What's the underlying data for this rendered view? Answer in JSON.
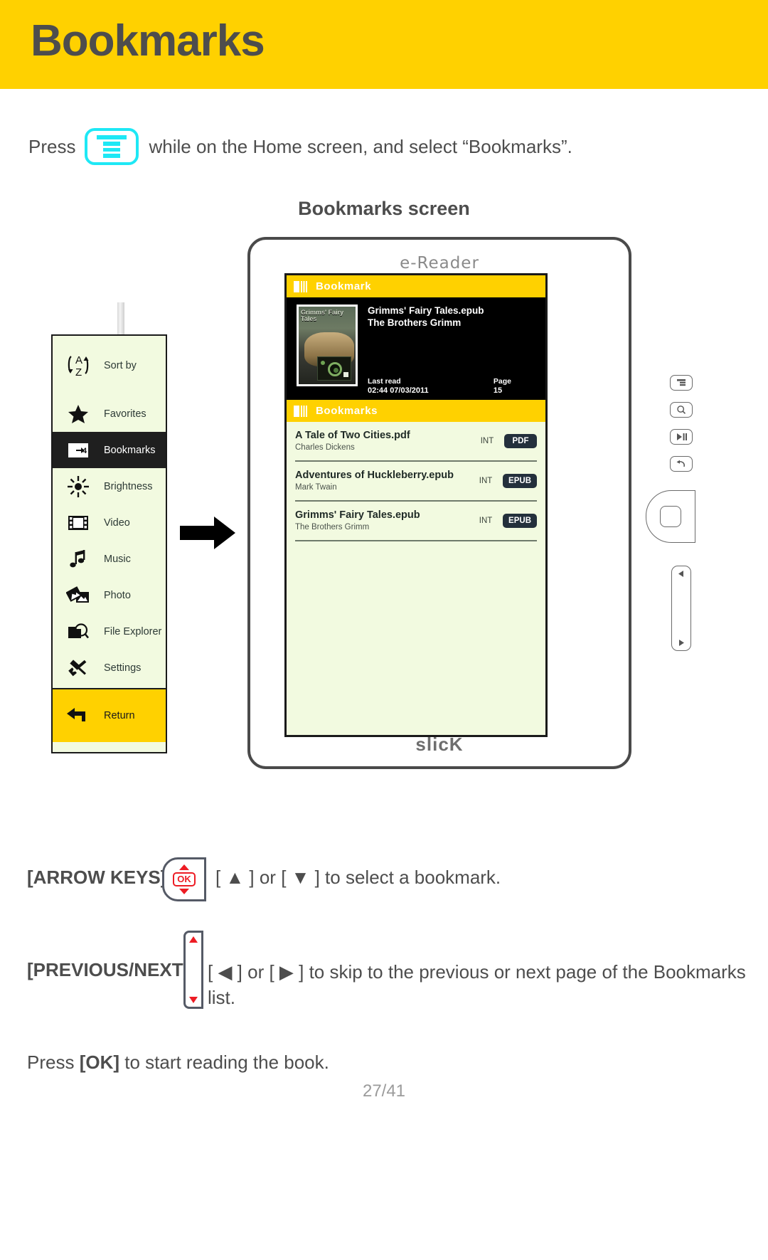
{
  "header": {
    "title": "Bookmarks"
  },
  "intro": {
    "pre": "Press",
    "icon": "menu-key-icon",
    "post": "while on the Home screen, and select “Bookmarks”."
  },
  "section": {
    "title": "Bookmarks screen"
  },
  "sidebar": {
    "items": [
      {
        "label": "Sort by",
        "icon": "sort-az-icon",
        "state": "normal"
      },
      {
        "label": "Favorites",
        "icon": "star-icon",
        "state": "normal"
      },
      {
        "label": "Bookmarks",
        "icon": "bookmarks-icon",
        "state": "selected"
      },
      {
        "label": "Brightness",
        "icon": "sun-icon",
        "state": "normal"
      },
      {
        "label": "Video",
        "icon": "film-icon",
        "state": "normal"
      },
      {
        "label": "Music",
        "icon": "music-note-icon",
        "state": "normal"
      },
      {
        "label": "Photo",
        "icon": "photo-icon",
        "state": "normal"
      },
      {
        "label": "File Explorer",
        "icon": "folder-search-icon",
        "state": "normal"
      },
      {
        "label": "Settings",
        "icon": "tools-icon",
        "state": "normal"
      },
      {
        "label": "Return",
        "icon": "return-arrow-icon",
        "state": "highlight"
      }
    ]
  },
  "device": {
    "brand_top": "e-Reader",
    "brand_bottom": "slicK",
    "screen": {
      "header_bar": {
        "label": "Bookmark",
        "icon": "book-icon"
      },
      "detail": {
        "title": "Grimms' Fairy Tales.epub",
        "author": "The Brothers Grimm",
        "cover_title": "Grimms' Fairy Tales",
        "last_read_label": "Last read",
        "last_read_value": "02:44 07/03/2011",
        "page_label": "Page",
        "page_value": "15"
      },
      "list_bar": {
        "label": "Bookmarks",
        "icon": "book-icon"
      },
      "rows": [
        {
          "title": "A Tale of Two Cities.pdf",
          "author": "Charles Dickens",
          "location": "INT",
          "format": "PDF"
        },
        {
          "title": "Adventures of Huckleberry.epub",
          "author": "Mark Twain",
          "location": "INT",
          "format": "EPUB"
        },
        {
          "title": "Grimms' Fairy Tales.epub",
          "author": "The Brothers Grimm",
          "location": "INT",
          "format": "EPUB"
        }
      ]
    },
    "hw_buttons": [
      {
        "name": "menu-button",
        "glyph": "menu-icon"
      },
      {
        "name": "zoom-button",
        "glyph": "magnifier-icon"
      },
      {
        "name": "play-pause-button",
        "glyph": "play-pause-icon"
      },
      {
        "name": "back-button",
        "glyph": "back-arrow-icon"
      },
      {
        "name": "ok-button",
        "glyph": "ok-square-icon"
      },
      {
        "name": "prev-next-rocker",
        "glyph": "prev-next-icon"
      }
    ]
  },
  "instructions": {
    "arrow_keys": {
      "key_label": "[ARROW KEYS]",
      "badge_ok": "OK",
      "text": "[ ▲ ] or [ ▼ ] to select a bookmark."
    },
    "prev_next": {
      "key_label": "[PREVIOUS/NEXT]",
      "text": "[ ◀ ] or [ ▶ ] to skip to the previous or next page of the Bookmarks list."
    },
    "ok_note_pre": "Press ",
    "ok_note_bold": "[OK]",
    "ok_note_post": " to start reading the book."
  },
  "footer": {
    "page": "27/41"
  },
  "colors": {
    "brand_yellow": "#FFD100",
    "screen_bg": "#F2FAE0",
    "accent_cyan": "#1EE8F5",
    "badge_navy": "#24303C",
    "red": "#ED1C24"
  }
}
